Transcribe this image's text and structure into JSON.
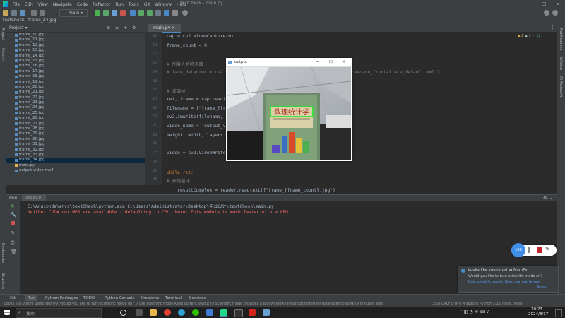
{
  "app": {
    "menu": [
      "File",
      "Edit",
      "View",
      "Navigate",
      "Code",
      "Refactor",
      "Run",
      "Tools",
      "Git",
      "Window",
      "Help"
    ],
    "window_title": "textCheck - main.py",
    "run_config": "main"
  },
  "breadcrumb": {
    "project": "textCheck",
    "file": "frame_24.jpg"
  },
  "project_panel": {
    "title": "Project",
    "files": [
      "frame_10.jpg",
      "frame_11.jpg",
      "frame_12.jpg",
      "frame_13.jpg",
      "frame_14.jpg",
      "frame_15.jpg",
      "frame_16.jpg",
      "frame_17.jpg",
      "frame_18.jpg",
      "frame_19.jpg",
      "frame_20.jpg",
      "frame_21.jpg",
      "frame_22.jpg",
      "frame_23.jpg",
      "frame_24.jpg",
      "frame_25.jpg",
      "frame_26.jpg",
      "frame_27.jpg",
      "frame_28.jpg",
      "frame_29.jpg",
      "frame_30.jpg",
      "frame_31.jpg",
      "frame_32.jpg",
      "frame_33.jpg",
      "frame_34.jpg",
      "main.py",
      "output video.mp4"
    ],
    "selected": "frame_34.jpg"
  },
  "editor": {
    "tab": "main.py",
    "line_numbers": [
      "10",
      "11",
      "12",
      "13",
      "14",
      "15",
      "16",
      "17",
      "18",
      "19",
      "20",
      "21",
      "22",
      "23",
      "24",
      "25",
      "26"
    ],
    "lines": [
      "cap = cv2.VideoCapture(0)",
      "frame_count = 0",
      "",
      "# 加载人脸检测器",
      "# face_detector = cv2.CascadeClassifier(cv2.data.haarcascades + 'haarcascade_frontalface_default.xml')",
      "",
      "# 读取帧",
      "ret, frame = cap.read()",
      "filename = f\"frame_{frame_count}.jpg\"",
      "cv2.imwrite(filename, frame)",
      "video_name = 'output_video.mp4'",
      "height, width, layers = frame.shape",
      "",
      "video = cv2.VideoWriter(video_name, 0, 1, (width, height))",
      "",
      "",
      "# 开始循环"
    ],
    "while_line": "while ret:",
    "while_ln": "26",
    "result_line": "    resultComplex = reader.readtext(f\"frame_{frame_count}.jpg\")",
    "result_ln": "28"
  },
  "output_window": {
    "title": "output",
    "book_title": "数理统计学"
  },
  "run": {
    "label": "Run:",
    "config": "main",
    "command": "E:\\Anaconda\\envs\\textCheck\\python.exe C:\\Users\\Administrator\\Desktop\\毕业设计\\textCheck\\main.py",
    "warning": "Neither CUDA nor MPS are available - defaulting to CPU. Note: This module is much faster with a GPU."
  },
  "bottom_tabs": [
    "Git",
    "Run",
    "Python Packages",
    "TODO",
    "Python Console",
    "Problems",
    "Terminal",
    "Services"
  ],
  "status": {
    "left": "Looks like you're using NumPy: Would you like to turn scientific mode on? // Use scientific mode  Keep current layout (// Scientific mode provides a tool window layout optimized for data science work (9 minutes ago)",
    "right": "3:18  CRLF  UTF-8  4 spaces  Python 3.11 (textCheck)"
  },
  "notification": {
    "title": "Looks like you're using NumPy",
    "body": "Would you like to turn scientific mode on?",
    "action1": "Use scientific mode",
    "action2": "Keep current layout",
    "more": "More..."
  },
  "capture": {
    "badge": "100"
  },
  "taskbar": {
    "search_placeholder": "搜索",
    "time": "10:23",
    "date": "2024/3/17"
  },
  "colors": {
    "accent": "#4a88c7",
    "error_text": "#ff6b68",
    "keyword": "#cc7832",
    "comment": "#808080",
    "string": "#6a8759"
  }
}
